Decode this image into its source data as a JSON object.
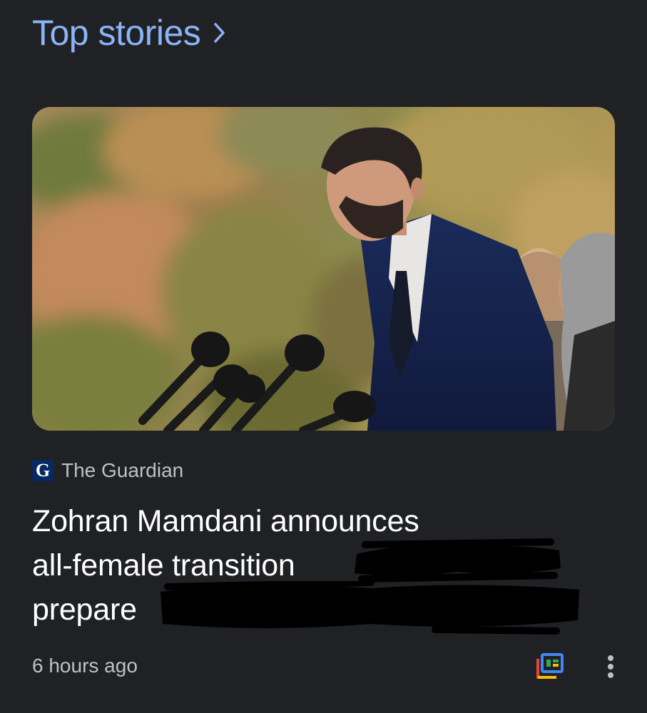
{
  "section": {
    "title": "Top stories",
    "chevron_icon": "chevron-right-icon"
  },
  "article": {
    "image_alt": "Man in dark suit speaking at microphones outdoors with women standing behind him",
    "source": {
      "logo_letter": "G",
      "name": "The Guardian"
    },
    "headline_lines": [
      "Zohran Mamdani announces",
      "all-female transition",
      "prepare"
    ],
    "timestamp": "6 hours ago",
    "full_coverage_icon": "full-coverage-icon",
    "more_icon": "more-vert-icon"
  },
  "colors": {
    "background": "#202124",
    "accent_blue": "#8ab4f8",
    "secondary_text": "#bdc1c6",
    "headline_text": "#ffffff",
    "guardian_blue": "#052962"
  }
}
